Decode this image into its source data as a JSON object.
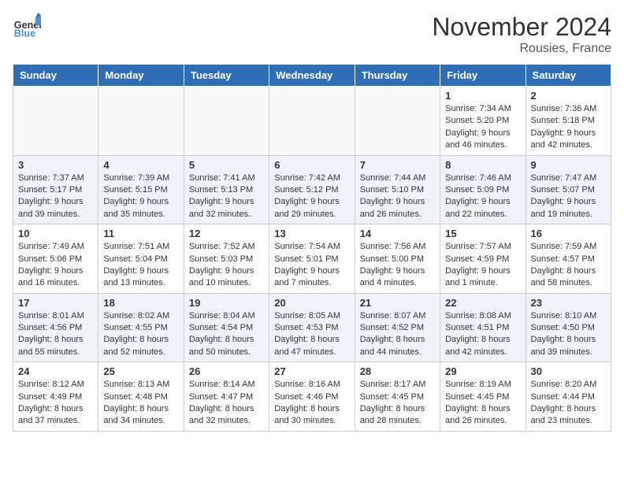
{
  "logo": {
    "general": "General",
    "blue": "Blue"
  },
  "title": "November 2024",
  "subtitle": "Rousies, France",
  "weekdays": [
    "Sunday",
    "Monday",
    "Tuesday",
    "Wednesday",
    "Thursday",
    "Friday",
    "Saturday"
  ],
  "weeks": [
    [
      {
        "day": "",
        "info": ""
      },
      {
        "day": "",
        "info": ""
      },
      {
        "day": "",
        "info": ""
      },
      {
        "day": "",
        "info": ""
      },
      {
        "day": "",
        "info": ""
      },
      {
        "day": "1",
        "info": "Sunrise: 7:34 AM\nSunset: 5:20 PM\nDaylight: 9 hours and 46 minutes."
      },
      {
        "day": "2",
        "info": "Sunrise: 7:36 AM\nSunset: 5:18 PM\nDaylight: 9 hours and 42 minutes."
      }
    ],
    [
      {
        "day": "3",
        "info": "Sunrise: 7:37 AM\nSunset: 5:17 PM\nDaylight: 9 hours and 39 minutes."
      },
      {
        "day": "4",
        "info": "Sunrise: 7:39 AM\nSunset: 5:15 PM\nDaylight: 9 hours and 35 minutes."
      },
      {
        "day": "5",
        "info": "Sunrise: 7:41 AM\nSunset: 5:13 PM\nDaylight: 9 hours and 32 minutes."
      },
      {
        "day": "6",
        "info": "Sunrise: 7:42 AM\nSunset: 5:12 PM\nDaylight: 9 hours and 29 minutes."
      },
      {
        "day": "7",
        "info": "Sunrise: 7:44 AM\nSunset: 5:10 PM\nDaylight: 9 hours and 26 minutes."
      },
      {
        "day": "8",
        "info": "Sunrise: 7:46 AM\nSunset: 5:09 PM\nDaylight: 9 hours and 22 minutes."
      },
      {
        "day": "9",
        "info": "Sunrise: 7:47 AM\nSunset: 5:07 PM\nDaylight: 9 hours and 19 minutes."
      }
    ],
    [
      {
        "day": "10",
        "info": "Sunrise: 7:49 AM\nSunset: 5:06 PM\nDaylight: 9 hours and 16 minutes."
      },
      {
        "day": "11",
        "info": "Sunrise: 7:51 AM\nSunset: 5:04 PM\nDaylight: 9 hours and 13 minutes."
      },
      {
        "day": "12",
        "info": "Sunrise: 7:52 AM\nSunset: 5:03 PM\nDaylight: 9 hours and 10 minutes."
      },
      {
        "day": "13",
        "info": "Sunrise: 7:54 AM\nSunset: 5:01 PM\nDaylight: 9 hours and 7 minutes."
      },
      {
        "day": "14",
        "info": "Sunrise: 7:56 AM\nSunset: 5:00 PM\nDaylight: 9 hours and 4 minutes."
      },
      {
        "day": "15",
        "info": "Sunrise: 7:57 AM\nSunset: 4:59 PM\nDaylight: 9 hours and 1 minute."
      },
      {
        "day": "16",
        "info": "Sunrise: 7:59 AM\nSunset: 4:57 PM\nDaylight: 8 hours and 58 minutes."
      }
    ],
    [
      {
        "day": "17",
        "info": "Sunrise: 8:01 AM\nSunset: 4:56 PM\nDaylight: 8 hours and 55 minutes."
      },
      {
        "day": "18",
        "info": "Sunrise: 8:02 AM\nSunset: 4:55 PM\nDaylight: 8 hours and 52 minutes."
      },
      {
        "day": "19",
        "info": "Sunrise: 8:04 AM\nSunset: 4:54 PM\nDaylight: 8 hours and 50 minutes."
      },
      {
        "day": "20",
        "info": "Sunrise: 8:05 AM\nSunset: 4:53 PM\nDaylight: 8 hours and 47 minutes."
      },
      {
        "day": "21",
        "info": "Sunrise: 8:07 AM\nSunset: 4:52 PM\nDaylight: 8 hours and 44 minutes."
      },
      {
        "day": "22",
        "info": "Sunrise: 8:08 AM\nSunset: 4:51 PM\nDaylight: 8 hours and 42 minutes."
      },
      {
        "day": "23",
        "info": "Sunrise: 8:10 AM\nSunset: 4:50 PM\nDaylight: 8 hours and 39 minutes."
      }
    ],
    [
      {
        "day": "24",
        "info": "Sunrise: 8:12 AM\nSunset: 4:49 PM\nDaylight: 8 hours and 37 minutes."
      },
      {
        "day": "25",
        "info": "Sunrise: 8:13 AM\nSunset: 4:48 PM\nDaylight: 8 hours and 34 minutes."
      },
      {
        "day": "26",
        "info": "Sunrise: 8:14 AM\nSunset: 4:47 PM\nDaylight: 8 hours and 32 minutes."
      },
      {
        "day": "27",
        "info": "Sunrise: 8:16 AM\nSunset: 4:46 PM\nDaylight: 8 hours and 30 minutes."
      },
      {
        "day": "28",
        "info": "Sunrise: 8:17 AM\nSunset: 4:45 PM\nDaylight: 8 hours and 28 minutes."
      },
      {
        "day": "29",
        "info": "Sunrise: 8:19 AM\nSunset: 4:45 PM\nDaylight: 8 hours and 26 minutes."
      },
      {
        "day": "30",
        "info": "Sunrise: 8:20 AM\nSunset: 4:44 PM\nDaylight: 8 hours and 23 minutes."
      }
    ]
  ]
}
